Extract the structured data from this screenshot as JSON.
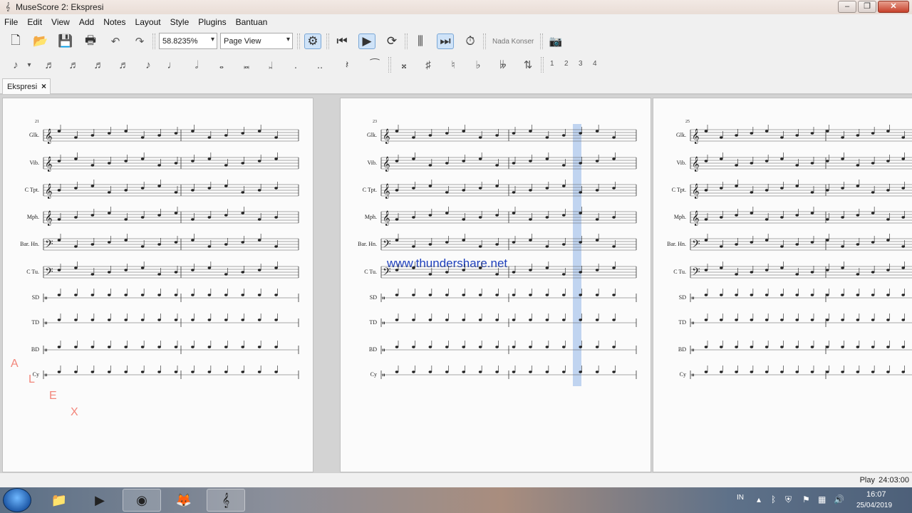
{
  "window": {
    "title": "MuseScore 2: Ekspresi",
    "app_icon": "musescore-icon",
    "buttons": [
      "minimize",
      "maximize",
      "close"
    ]
  },
  "menu": [
    "File",
    "Edit",
    "View",
    "Add",
    "Notes",
    "Layout",
    "Style",
    "Plugins",
    "Bantuan"
  ],
  "toolbar": {
    "zoom_value": "58.8235%",
    "view_mode": "Page View",
    "concert_pitch_label": "Nada Konser"
  },
  "note_input": {
    "voices": [
      "1",
      "2",
      "3",
      "4"
    ]
  },
  "tabs": [
    {
      "label": "Ekspresi",
      "close": "×"
    }
  ],
  "score": {
    "page1": {
      "measure_number": "21",
      "instruments": [
        "Glk.",
        "Vib.",
        "C Tpt.",
        "Mph.",
        "Bar. Hn.",
        "C Tu.",
        "SD",
        "TD",
        "BD",
        "Cy"
      ]
    },
    "page2": {
      "measure_number": "23",
      "instruments": [
        "Glk.",
        "Vib.",
        "C Tpt.",
        "Mph.",
        "Bar. Hn.",
        "C Tu.",
        "SD",
        "TD",
        "BD",
        "Cy"
      ]
    },
    "page3": {
      "measure_number": "25",
      "instruments": [
        "Glk.",
        "Vib.",
        "C Tpt.",
        "Mph.",
        "Bar. Hn.",
        "C Tu.",
        "SD",
        "TD",
        "BD",
        "Cy"
      ]
    },
    "watermark": "www.thundershare.net",
    "overlay_letters": [
      "A",
      "L",
      "E",
      "X"
    ]
  },
  "status": {
    "mode": "Play",
    "time": "24:03:00"
  },
  "taskbar": {
    "language": "IN",
    "clock_time": "16:07",
    "clock_date": "25/04/2019"
  },
  "colors": {
    "accent": "#3a7bd5",
    "playback_cursor": "#8fb5e8",
    "watermark": "#1d3fbd"
  }
}
